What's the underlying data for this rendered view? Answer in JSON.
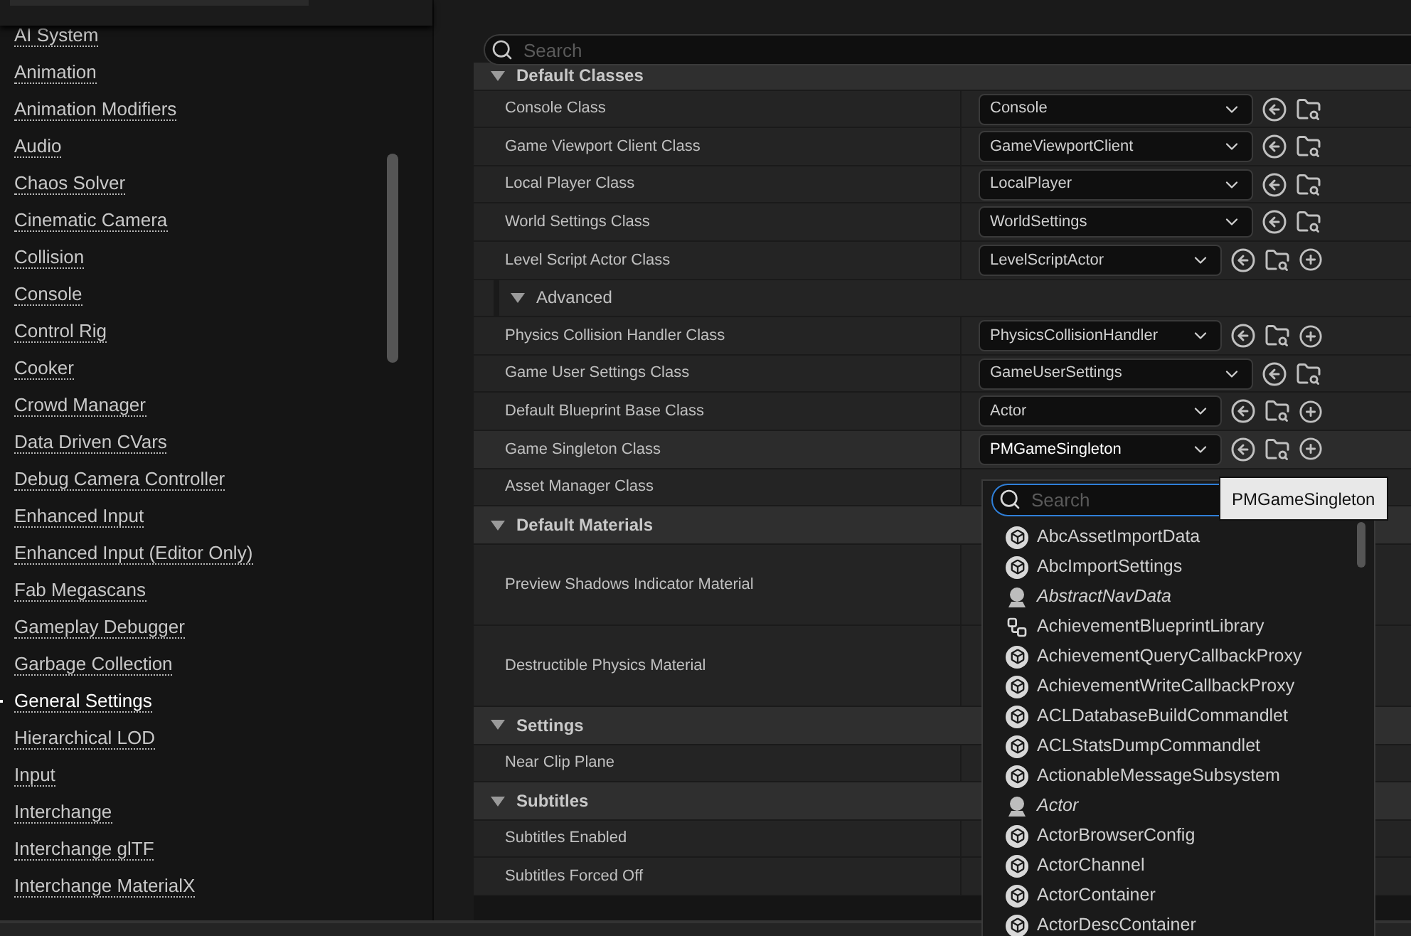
{
  "sidebar": {
    "items": [
      {
        "label": "AI System",
        "selected": false
      },
      {
        "label": "Animation",
        "selected": false
      },
      {
        "label": "Animation Modifiers",
        "selected": false
      },
      {
        "label": "Audio",
        "selected": false
      },
      {
        "label": "Chaos Solver",
        "selected": false
      },
      {
        "label": "Cinematic Camera",
        "selected": false
      },
      {
        "label": "Collision",
        "selected": false
      },
      {
        "label": "Console",
        "selected": false
      },
      {
        "label": "Control Rig",
        "selected": false
      },
      {
        "label": "Cooker",
        "selected": false
      },
      {
        "label": "Crowd Manager",
        "selected": false
      },
      {
        "label": "Data Driven CVars",
        "selected": false
      },
      {
        "label": "Debug Camera Controller",
        "selected": false
      },
      {
        "label": "Enhanced Input",
        "selected": false
      },
      {
        "label": "Enhanced Input (Editor Only)",
        "selected": false
      },
      {
        "label": "Fab Megascans",
        "selected": false
      },
      {
        "label": "Gameplay Debugger",
        "selected": false
      },
      {
        "label": "Garbage Collection",
        "selected": false
      },
      {
        "label": "General Settings",
        "selected": true
      },
      {
        "label": "Hierarchical LOD",
        "selected": false
      },
      {
        "label": "Input",
        "selected": false
      },
      {
        "label": "Interchange",
        "selected": false
      },
      {
        "label": "Interchange glTF",
        "selected": false
      },
      {
        "label": "Interchange MaterialX",
        "selected": false
      }
    ]
  },
  "search": {
    "placeholder": "Search"
  },
  "properties": [
    {
      "kind": "category",
      "label": "Default Classes"
    },
    {
      "kind": "class",
      "label": "Console Class",
      "value": "Console",
      "add": false,
      "selected": false
    },
    {
      "kind": "class",
      "label": "Game Viewport Client Class",
      "value": "GameViewportClient",
      "add": false,
      "selected": false
    },
    {
      "kind": "class",
      "label": "Local Player Class",
      "value": "LocalPlayer",
      "add": false,
      "selected": false
    },
    {
      "kind": "class",
      "label": "World Settings Class",
      "value": "WorldSettings",
      "add": false,
      "selected": false
    },
    {
      "kind": "class",
      "label": "Level Script Actor Class",
      "value": "LevelScriptActor",
      "add": true,
      "selected": false
    },
    {
      "kind": "advanced",
      "label": "Advanced"
    },
    {
      "kind": "class",
      "label": "Physics Collision Handler Class",
      "value": "PhysicsCollisionHandler",
      "add": true,
      "selected": false
    },
    {
      "kind": "class",
      "label": "Game User Settings Class",
      "value": "GameUserSettings",
      "add": false,
      "selected": false
    },
    {
      "kind": "class",
      "label": "Default Blueprint Base Class",
      "value": "Actor",
      "add": true,
      "selected": false
    },
    {
      "kind": "class",
      "label": "Game Singleton Class",
      "value": "PMGameSingleton",
      "add": true,
      "selected": true
    },
    {
      "kind": "plain",
      "label": "Asset Manager Class"
    },
    {
      "kind": "category",
      "label": "Default Materials"
    },
    {
      "kind": "tall",
      "label": "Preview Shadows Indicator Material"
    },
    {
      "kind": "tall",
      "label": "Destructible Physics Material"
    },
    {
      "kind": "category",
      "label": "Settings"
    },
    {
      "kind": "plain",
      "label": "Near Clip Plane"
    },
    {
      "kind": "category",
      "label": "Subtitles"
    },
    {
      "kind": "plain",
      "label": "Subtitles Enabled"
    },
    {
      "kind": "plain",
      "label": "Subtitles Forced Off"
    }
  ],
  "picker": {
    "placeholder": "Search",
    "items": [
      {
        "label": "AbcAssetImportData",
        "kind": "class",
        "abstract": false
      },
      {
        "label": "AbcImportSettings",
        "kind": "class",
        "abstract": false
      },
      {
        "label": "AbstractNavData",
        "kind": "actor",
        "abstract": true
      },
      {
        "label": "AchievementBlueprintLibrary",
        "kind": "library",
        "abstract": false
      },
      {
        "label": "AchievementQueryCallbackProxy",
        "kind": "class",
        "abstract": false
      },
      {
        "label": "AchievementWriteCallbackProxy",
        "kind": "class",
        "abstract": false
      },
      {
        "label": "ACLDatabaseBuildCommandlet",
        "kind": "class",
        "abstract": false
      },
      {
        "label": "ACLStatsDumpCommandlet",
        "kind": "class",
        "abstract": false
      },
      {
        "label": "ActionableMessageSubsystem",
        "kind": "class",
        "abstract": false
      },
      {
        "label": "Actor",
        "kind": "actor",
        "abstract": true
      },
      {
        "label": "ActorBrowserConfig",
        "kind": "class",
        "abstract": false
      },
      {
        "label": "ActorChannel",
        "kind": "class",
        "abstract": false
      },
      {
        "label": "ActorContainer",
        "kind": "class",
        "abstract": false
      },
      {
        "label": "ActorDescContainer",
        "kind": "class",
        "abstract": false
      }
    ]
  },
  "tooltip": "PMGameSingleton"
}
